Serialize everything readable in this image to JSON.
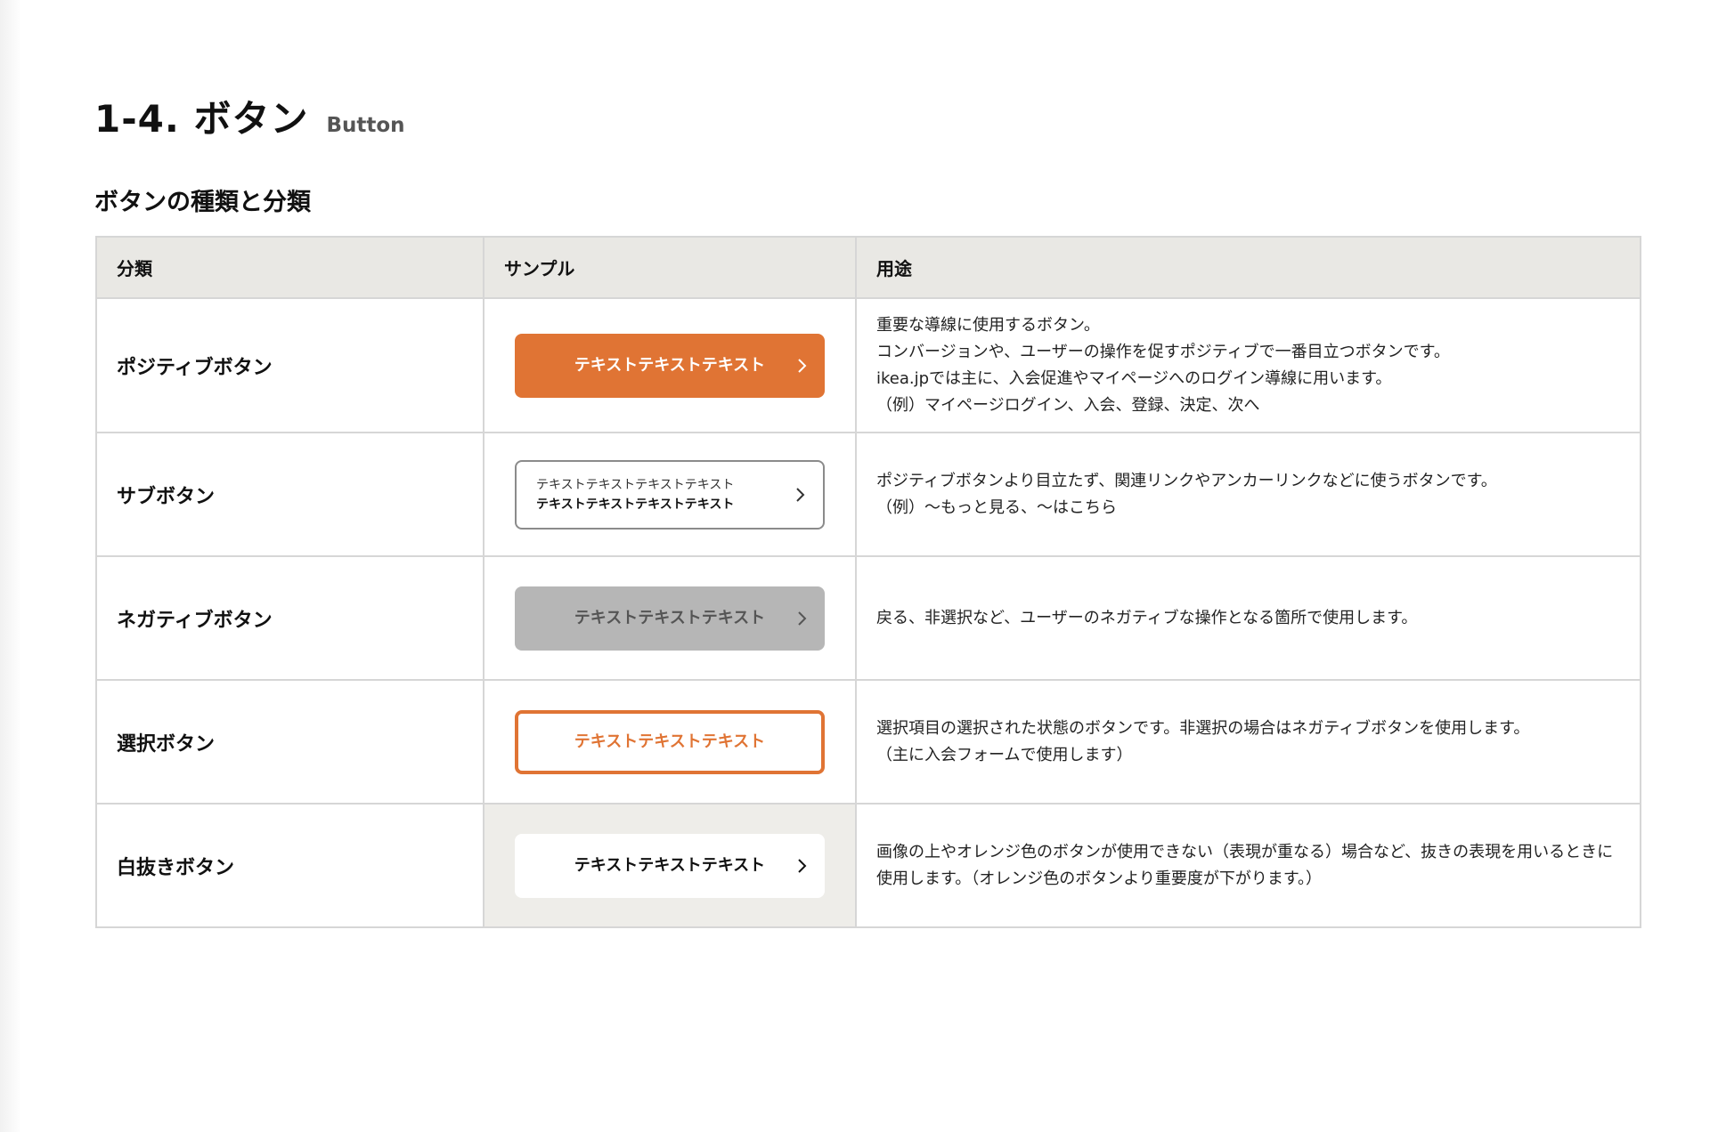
{
  "page": {
    "title": "1-4. ボタン",
    "subtitle": "Button",
    "section_title": "ボタンの種類と分類"
  },
  "colors": {
    "accent_orange": "#e07434",
    "negative_gray": "#b6b6b6",
    "header_bg": "#e9e8e4",
    "border": "#d6d6d6"
  },
  "table": {
    "headers": [
      "分類",
      "サンプル",
      "用途"
    ],
    "rows": [
      {
        "category": "ポジティブボタン",
        "sample_label": "テキストテキストテキスト",
        "icon": "chevron-right-icon",
        "usage": [
          "重要な導線に使用するボタン。",
          "コンバージョンや、ユーザーの操作を促すポジティブで一番目立つボタンです。",
          "ikea.jpでは主に、入会促進やマイページへのログイン導線に用います。",
          "（例）マイページログイン、入会、登録、決定、次へ"
        ]
      },
      {
        "category": "サブボタン",
        "sample_line1": "テキストテキストテキストテキスト",
        "sample_line2": "テキストテキストテキストテキスト",
        "icon": "chevron-right-icon",
        "usage": [
          "ポジティブボタンより目立たず、関連リンクやアンカーリンクなどに使うボタンです。",
          "（例）～もっと見る、～はこちら"
        ]
      },
      {
        "category": "ネガティブボタン",
        "sample_label": "テキストテキストテキスト",
        "icon": "chevron-right-icon",
        "usage": [
          "戻る、非選択など、ユーザーのネガティブな操作となる箇所で使用します。"
        ]
      },
      {
        "category": "選択ボタン",
        "sample_label": "テキストテキストテキスト",
        "usage": [
          "選択項目の選択された状態のボタンです。非選択の場合はネガティブボタンを使用します。",
          "（主に入会フォームで使用します）"
        ]
      },
      {
        "category": "白抜きボタン",
        "sample_label": "テキストテキストテキスト",
        "icon": "chevron-right-icon",
        "usage": [
          "画像の上やオレンジ色のボタンが使用できない（表現が重なる）場合など、抜きの表現を用いるときに使用します。（オレンジ色のボタンより重要度が下がります。）"
        ]
      }
    ]
  }
}
